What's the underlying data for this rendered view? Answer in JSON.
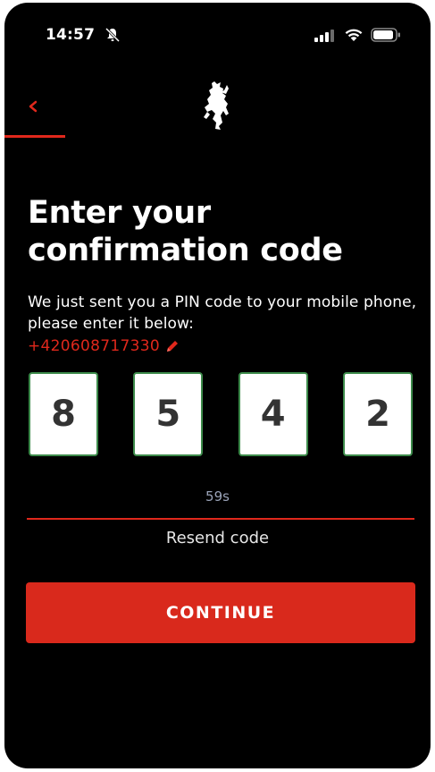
{
  "status_bar": {
    "time": "14:57",
    "icons": [
      "bell-slash-icon",
      "cellular-signal-icon",
      "wifi-icon",
      "battery-icon"
    ]
  },
  "nav": {
    "back_icon": "chevron-left-icon",
    "logo": "prancing-horse-logo"
  },
  "content": {
    "title": "Enter your confirmation code",
    "subtitle": "We just sent you a PIN code to your mobile phone, please enter it below:",
    "phone_number": "+420608717330",
    "edit_icon": "pencil-icon",
    "pin_digits": [
      "8",
      "5",
      "4",
      "2"
    ],
    "timer": "59s",
    "resend_label": "Resend code",
    "continue_label": "CONTINUE"
  },
  "colors": {
    "background": "#000000",
    "accent_red": "#e0281c",
    "button_red": "#d9291c",
    "pin_border": "#3c8a4a",
    "timer_text": "#9aa3b8"
  }
}
